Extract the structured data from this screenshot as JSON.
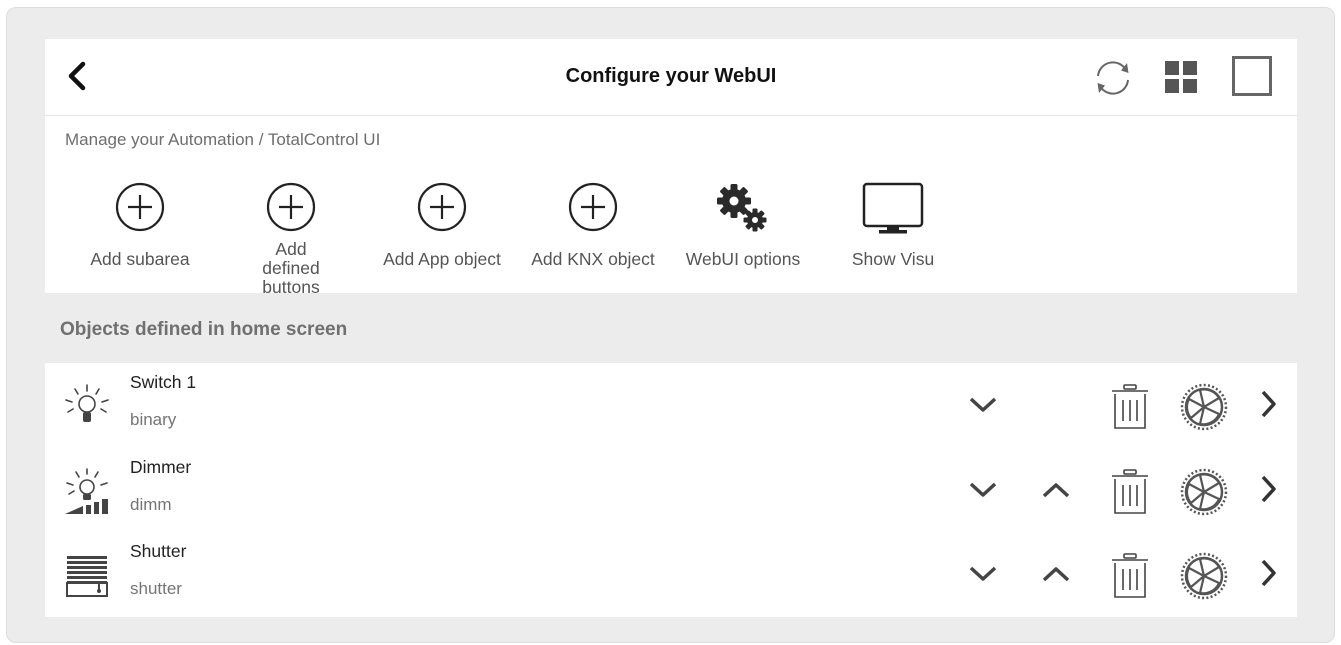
{
  "header": {
    "title": "Configure your WebUI",
    "icons": [
      "back-chevron-icon",
      "refresh-icon",
      "grid-icon",
      "fullscreen-icon"
    ]
  },
  "manage_text": "Manage your Automation / TotalControl UI",
  "toolbar": {
    "items": [
      {
        "label": "Add subarea",
        "icon": "add-circle-icon"
      },
      {
        "label": "Add defined buttons",
        "icon": "add-circle-icon"
      },
      {
        "label": "Add App object",
        "icon": "add-circle-icon"
      },
      {
        "label": "Add KNX object",
        "icon": "add-circle-icon"
      },
      {
        "label": "WebUI options",
        "icon": "gears-icon"
      },
      {
        "label": "Show Visu",
        "icon": "monitor-icon"
      }
    ]
  },
  "section": {
    "title": "Objects defined in home screen"
  },
  "objects": [
    {
      "name": "Switch 1",
      "type": "binary",
      "icon": "lightbulb-icon",
      "actions": [
        "move-down",
        "delete",
        "settings",
        "open"
      ]
    },
    {
      "name": "Dimmer",
      "type": "dimm",
      "icon": "dimmer-bulb-icon",
      "actions": [
        "move-down",
        "move-up",
        "delete",
        "settings",
        "open"
      ]
    },
    {
      "name": "Shutter",
      "type": "shutter",
      "icon": "shutter-icon",
      "actions": [
        "move-down",
        "move-up",
        "delete",
        "settings",
        "open"
      ]
    }
  ],
  "colors": {
    "frame": "#ececec",
    "panel": "#ffffff",
    "section_band": "#ececec",
    "icon_dark": "#333333",
    "icon_gray": "#666666",
    "text_gray": "#6e6e6e"
  }
}
